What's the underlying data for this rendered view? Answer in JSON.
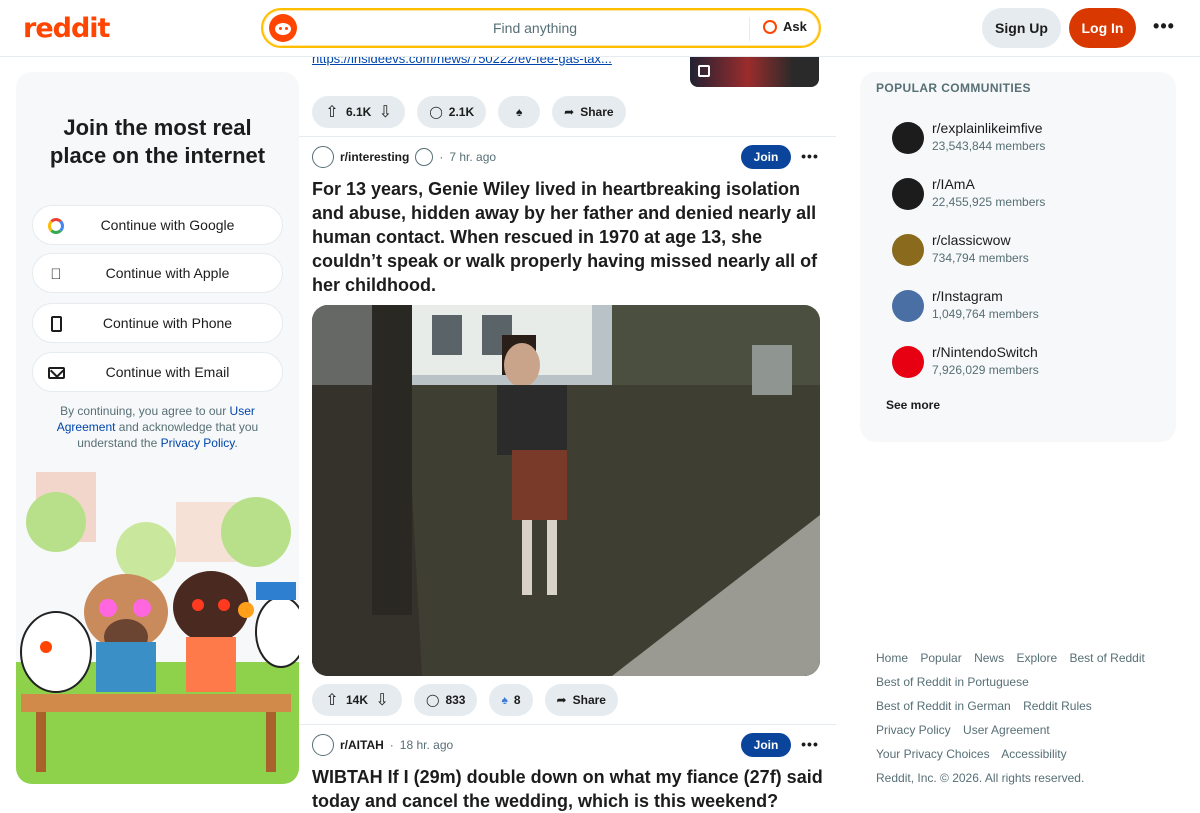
{
  "header": {
    "logo": "reddit",
    "search_placeholder": "Find anything",
    "ask_label": "Ask",
    "signup_label": "Sign Up",
    "login_label": "Log In",
    "more_label": "•••"
  },
  "auth_panel": {
    "title": "Join the most real place on the internet",
    "buttons": [
      {
        "label": "Continue with Google",
        "icon": "google-icon"
      },
      {
        "label": "Continue with Apple",
        "icon": "apple-icon"
      },
      {
        "label": "Continue with Phone",
        "icon": "phone-icon"
      },
      {
        "label": "Continue with Email",
        "icon": "email-icon"
      }
    ],
    "legal_prefix": "By continuing, you agree to our",
    "legal_link_1": "User Agreement",
    "legal_middle": "and acknowledge that you understand the",
    "legal_link_2": "Privacy Policy",
    "legal_suffix": "."
  },
  "feed": {
    "prev_link": "https://insideevs.com/news/750222/ev-fee-gas-tax...",
    "posts": [
      {
        "upvotes": "6.1K",
        "comments": "2.1K",
        "share_label": "Share"
      },
      {
        "subreddit": "r/interesting",
        "age": "7 hr. ago",
        "join_label": "Join",
        "title": "For 13 years, Genie Wiley lived in heartbreaking isolation and abuse, hidden away by her father and denied nearly all human contact. When rescued in 1970 at age 13, she couldn’t speak or walk properly having missed nearly all of her childhood.",
        "upvotes": "14K",
        "comments": "833",
        "awards": "8",
        "share_label": "Share"
      },
      {
        "subreddit": "r/AITAH",
        "age": "18 hr. ago",
        "join_label": "Join",
        "title": "WIBTAH If I (29m) double down on what my fiance (27f) said today and cancel the wedding, which is this weekend?"
      }
    ]
  },
  "sidebar": {
    "title": "POPULAR COMMUNITIES",
    "communities": [
      {
        "name": "r/explainlikeimfive",
        "members": "23,543,844 members",
        "color": "#1c1c1c"
      },
      {
        "name": "r/IAmA",
        "members": "22,455,925 members",
        "color": "#1c1c1c"
      },
      {
        "name": "r/classicwow",
        "members": "734,794 members",
        "color": "#8a6a1c"
      },
      {
        "name": "r/Instagram",
        "members": "1,049,764 members",
        "color": "#4a6fa5"
      },
      {
        "name": "r/NintendoSwitch",
        "members": "7,926,029 members",
        "color": "#e60012"
      }
    ],
    "see_more": "See more"
  },
  "footer": {
    "links": [
      "Home",
      "Popular",
      "News",
      "Explore",
      "Best of Reddit",
      "Best of Reddit in Portuguese",
      "Best of Reddit in German",
      "Reddit Rules",
      "Privacy Policy",
      "User Agreement",
      "Your Privacy Choices",
      "Accessibility"
    ],
    "copyright": "Reddit, Inc. © 2026. All rights reserved."
  },
  "colors": {
    "brand": "#ff4500",
    "login": "#d93900",
    "join": "#0a449b",
    "link": "#0045ac"
  }
}
